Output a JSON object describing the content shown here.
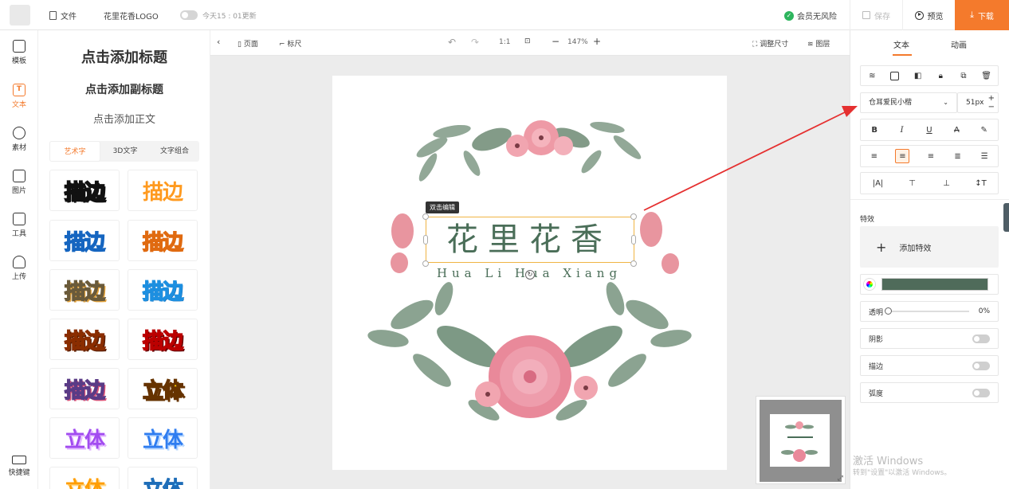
{
  "topbar": {
    "file_label": "文件",
    "project_name": "花里花香LOGO",
    "update_time": "今天15 : 01更新",
    "member_risk": "会员无风险",
    "save_label": "保存",
    "preview_label": "预览",
    "download_label": "下载"
  },
  "leftnav": {
    "items": [
      {
        "label": "模板",
        "icon": "shirt-icon"
      },
      {
        "label": "文本",
        "icon": "text-icon",
        "glyph": "T"
      },
      {
        "label": "素材",
        "icon": "shapes-icon"
      },
      {
        "label": "图片",
        "icon": "image-icon"
      },
      {
        "label": "工具",
        "icon": "toolbox-icon"
      },
      {
        "label": "上传",
        "icon": "upload-cloud-icon"
      }
    ],
    "shortcut_label": "快捷键"
  },
  "panel": {
    "add_title": "点击添加标题",
    "add_subtitle": "点击添加副标题",
    "add_body": "点击添加正文",
    "subtabs": [
      "艺术字",
      "3D文字",
      "文字组合"
    ],
    "tiles": [
      "描边",
      "描边",
      "描边",
      "描边",
      "描边",
      "描边",
      "描边",
      "描边",
      "描边",
      "立体",
      "立体",
      "立体",
      "立体",
      "立体"
    ]
  },
  "canvas_toolbar": {
    "page_label": "页面",
    "ruler_label": "标尺",
    "ratio_label": "1:1",
    "zoom": "147%",
    "resize_label": "调整尺寸",
    "layers_label": "图层"
  },
  "artboard": {
    "tooltip": "双击编辑",
    "logo_title": "花里花香",
    "logo_subtitle": "Hua Li Hua Xiang"
  },
  "rightpanel": {
    "tabs": [
      "文本",
      "动画"
    ],
    "font_name": "仓耳爱民小楷",
    "font_size": "51px",
    "effects_label": "特效",
    "add_effect_label": "添加特效",
    "text_color": "#4f6b5a",
    "opacity_label": "透明",
    "opacity_value": "0%",
    "shadow_label": "阴影",
    "stroke_label": "描边",
    "curve_label": "弧度"
  },
  "watermark": {
    "line1": "激活 Windows",
    "line2": "转到\"设置\"以激活 Windows。"
  },
  "colors": {
    "accent": "#f47a2c",
    "logo_green": "#4a6e58"
  }
}
